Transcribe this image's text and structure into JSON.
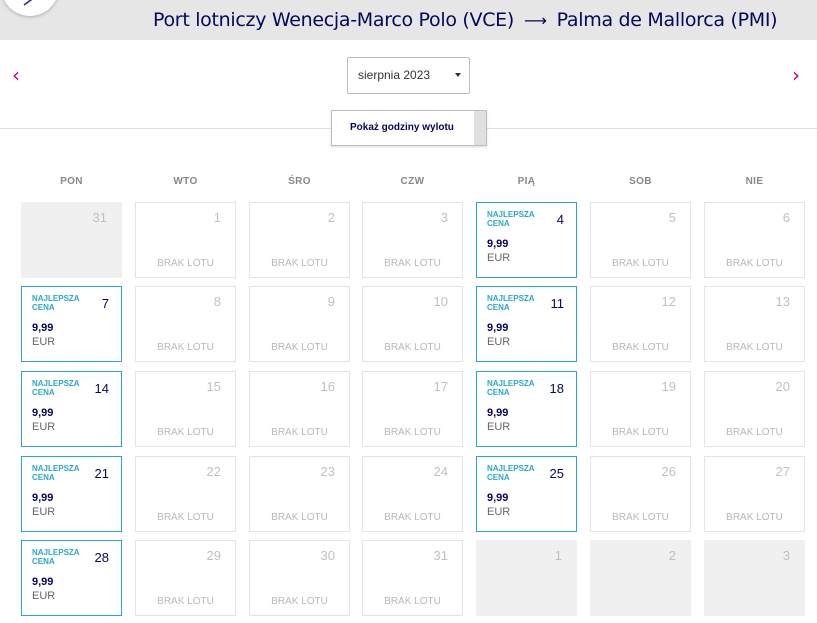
{
  "header": {
    "origin": "Port lotniczy Wenecja-Marco Polo (VCE)",
    "arrow": "⟶",
    "destination": "Palma de Mallorca (PMI)"
  },
  "nav": {
    "prev": "‹",
    "next": "›"
  },
  "month_select": {
    "value": "sierpnia 2023"
  },
  "toggle": {
    "label": "Pokaż godziny wylotu"
  },
  "weekdays": [
    "PON",
    "WTO",
    "ŚRO",
    "CZW",
    "PIĄ",
    "SOB",
    "NIE"
  ],
  "labels": {
    "no_flight": "BRAK LOTU",
    "best_price": "NAJLEPSZA CENA"
  },
  "weeks": [
    [
      {
        "day": "31",
        "type": "muted"
      },
      {
        "day": "1",
        "type": "noflight"
      },
      {
        "day": "2",
        "type": "noflight"
      },
      {
        "day": "3",
        "type": "noflight"
      },
      {
        "day": "4",
        "type": "best",
        "price": "9,99",
        "currency": "EUR"
      },
      {
        "day": "5",
        "type": "noflight"
      },
      {
        "day": "6",
        "type": "noflight"
      }
    ],
    [
      {
        "day": "7",
        "type": "best",
        "price": "9,99",
        "currency": "EUR"
      },
      {
        "day": "8",
        "type": "noflight"
      },
      {
        "day": "9",
        "type": "noflight"
      },
      {
        "day": "10",
        "type": "noflight"
      },
      {
        "day": "11",
        "type": "best",
        "price": "9,99",
        "currency": "EUR"
      },
      {
        "day": "12",
        "type": "noflight"
      },
      {
        "day": "13",
        "type": "noflight"
      }
    ],
    [
      {
        "day": "14",
        "type": "best",
        "price": "9,99",
        "currency": "EUR"
      },
      {
        "day": "15",
        "type": "noflight"
      },
      {
        "day": "16",
        "type": "noflight"
      },
      {
        "day": "17",
        "type": "noflight"
      },
      {
        "day": "18",
        "type": "best",
        "price": "9,99",
        "currency": "EUR"
      },
      {
        "day": "19",
        "type": "noflight"
      },
      {
        "day": "20",
        "type": "noflight"
      }
    ],
    [
      {
        "day": "21",
        "type": "best",
        "price": "9,99",
        "currency": "EUR"
      },
      {
        "day": "22",
        "type": "noflight"
      },
      {
        "day": "23",
        "type": "noflight"
      },
      {
        "day": "24",
        "type": "noflight"
      },
      {
        "day": "25",
        "type": "best",
        "price": "9,99",
        "currency": "EUR"
      },
      {
        "day": "26",
        "type": "noflight"
      },
      {
        "day": "27",
        "type": "noflight"
      }
    ],
    [
      {
        "day": "28",
        "type": "best",
        "price": "9,99",
        "currency": "EUR"
      },
      {
        "day": "29",
        "type": "noflight"
      },
      {
        "day": "30",
        "type": "noflight"
      },
      {
        "day": "31",
        "type": "noflight"
      },
      {
        "day": "1",
        "type": "muted"
      },
      {
        "day": "2",
        "type": "muted"
      },
      {
        "day": "3",
        "type": "muted"
      }
    ]
  ]
}
